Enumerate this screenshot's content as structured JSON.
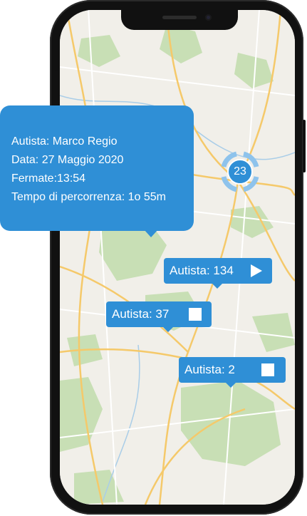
{
  "info_popup": {
    "lines": [
      "Autista: Marco Regio",
      "Data: 27 Maggio 2020",
      "Fermate:13:54",
      "Tempo di percorrenza: 1o 55m"
    ]
  },
  "cluster": {
    "count": "23"
  },
  "driver_tags": [
    {
      "label": "Autista: 134",
      "icon": "play-icon"
    },
    {
      "label": "Autista: 37",
      "icon": "stop-icon"
    },
    {
      "label": "Autista: 2",
      "icon": "stop-icon"
    }
  ],
  "colors": {
    "accent": "#2f8fd6",
    "map_land": "#f1efe9",
    "map_forest": "#c8dfb5",
    "road": "#f5c96a",
    "phone_frame": "#111111"
  }
}
